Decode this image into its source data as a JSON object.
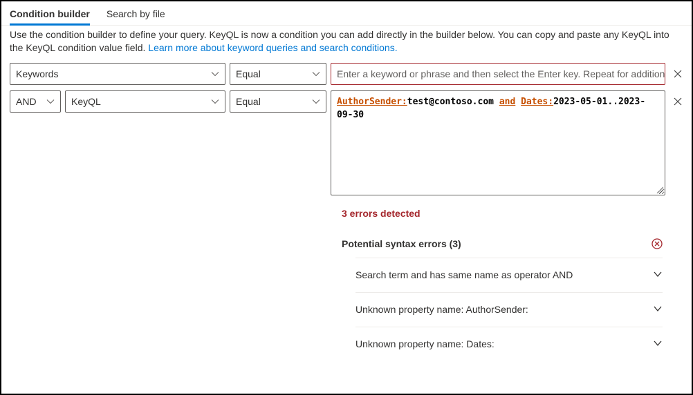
{
  "tabs": {
    "builder": "Condition builder",
    "byfile": "Search by file"
  },
  "description": {
    "text_a": "Use the condition builder to define your query. KeyQL is now a condition you can add directly in the builder below. You can copy and paste any KeyQL into the KeyQL condition value field. ",
    "link": "Learn more about keyword queries and search conditions."
  },
  "row1": {
    "property": "Keywords",
    "operator": "Equal",
    "placeholder": "Enter a keyword or phrase and then select the Enter key. Repeat for additional…"
  },
  "row2": {
    "bool": "AND",
    "property": "KeyQL",
    "operator": "Equal",
    "kql": {
      "p1": "AuthorSender:",
      "t1": "test@contoso.com ",
      "p2": "and",
      "sp": " ",
      "p3": "Dates:",
      "t2": "2023-05-01..2023-09-30"
    }
  },
  "errors": {
    "summary": "3 errors detected",
    "header": "Potential syntax errors (3)",
    "items": [
      "Search term and has same name as operator AND",
      "Unknown property name: AuthorSender:",
      "Unknown property name: Dates:"
    ]
  }
}
